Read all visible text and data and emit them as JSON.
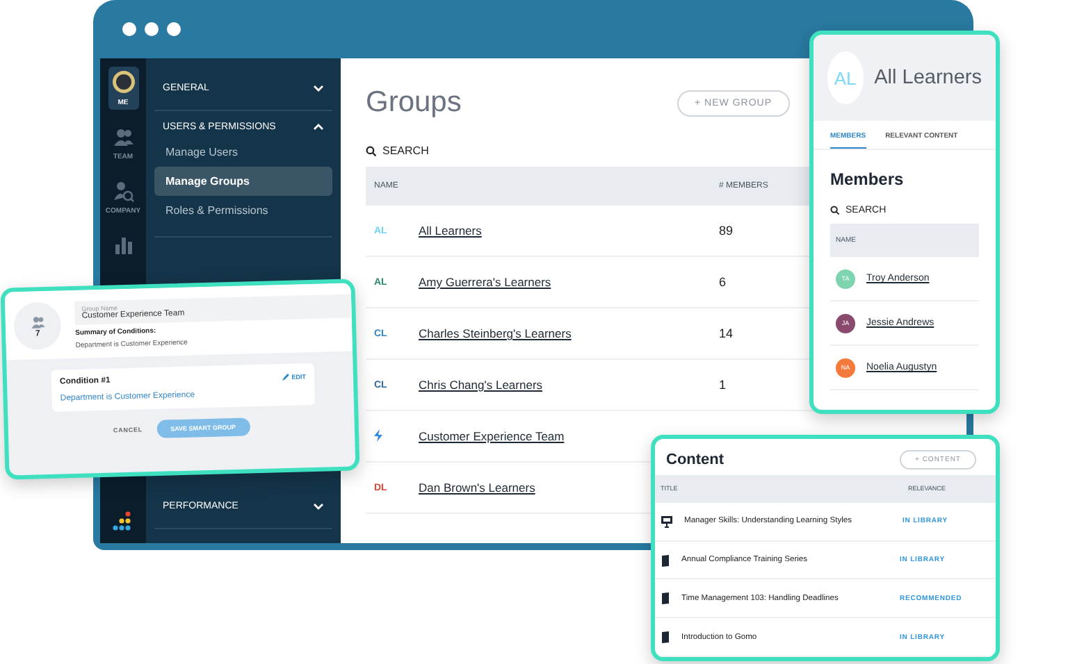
{
  "window": {
    "rail": [
      {
        "kind": "avatar",
        "label": "ME",
        "selected": true
      },
      {
        "kind": "team",
        "label": "TEAM",
        "selected": false
      },
      {
        "kind": "company",
        "label": "COMPANY",
        "selected": false
      },
      {
        "kind": "chart",
        "selected": false
      }
    ],
    "nav": [
      {
        "label": "GENERAL",
        "expanded": false
      },
      {
        "label": "USERS & PERMISSIONS",
        "expanded": true,
        "children": [
          {
            "label": "Manage Users",
            "selected": false
          },
          {
            "label": "Manage Groups",
            "selected": true
          },
          {
            "label": "Roles & Permissions",
            "selected": false
          }
        ]
      },
      {
        "label": "PERFORMANCE",
        "expanded": false
      }
    ]
  },
  "groups": {
    "title": "Groups",
    "new_button": "+ NEW GROUP",
    "search": "SEARCH",
    "columns": [
      "NAME",
      "# MEMBERS"
    ],
    "rows": [
      {
        "kind": "initials",
        "initials": "AL",
        "color": "#6fd3f5",
        "name": "All Learners",
        "members": "89"
      },
      {
        "kind": "initials",
        "initials": "AL",
        "color": "#2e8b6e",
        "name": "Amy Guerrera's Learners",
        "members": "6"
      },
      {
        "kind": "initials",
        "initials": "CL",
        "color": "#2f86c9",
        "name": "Charles Steinberg's Learners",
        "members": "14"
      },
      {
        "kind": "initials",
        "initials": "CL",
        "color": "#2e6aa0",
        "name": "Chris Chang's Learners",
        "members": "1"
      },
      {
        "kind": "smart",
        "color": "#2f86e0",
        "name": "Customer Experience Team"
      },
      {
        "kind": "initials",
        "initials": "DL",
        "color": "#e0463a",
        "name": "Dan Brown's Learners"
      }
    ]
  },
  "smart_group": {
    "count": "7",
    "field_label": "Group Name",
    "field_value": "Customer Experience Team",
    "summary_title": "Summary of Conditions:",
    "summary": "Department is Customer Experience",
    "condition_title": "Condition #1",
    "edit": "EDIT",
    "condition": "Department is Customer Experience",
    "cancel": "CANCEL",
    "save": "SAVE SMART GROUP"
  },
  "learner_card": {
    "initials": "AL",
    "title": "All Learners",
    "tabs": [
      {
        "label": "MEMBERS",
        "selected": true
      },
      {
        "label": "RELEVANT CONTENT",
        "selected": false
      }
    ],
    "heading": "Members",
    "search": "SEARCH",
    "column": "NAME",
    "members": [
      {
        "initials": "TA",
        "name": "Troy Anderson",
        "color": "#7fd4b0"
      },
      {
        "initials": "JA",
        "name": "Jessie Andrews",
        "color": "#8a4a6e"
      },
      {
        "initials": "NA",
        "name": "Noelia Augustyn",
        "color": "#f47a3c"
      }
    ]
  },
  "content_card": {
    "title": "Content",
    "add_button": "+ CONTENT",
    "columns": [
      "TITLE",
      "RELEVANCE"
    ],
    "rows": [
      {
        "kind": "presentation",
        "title": "Manager Skills: Understanding Learning Styles",
        "relevance": "IN LIBRARY"
      },
      {
        "kind": "book",
        "title": "Annual Compliance Training Series",
        "relevance": "IN LIBRARY"
      },
      {
        "kind": "book",
        "title": "Time Management 103: Handling Deadlines",
        "relevance": "RECOMMENDED"
      },
      {
        "kind": "book",
        "title": "Introduction to Gomo",
        "relevance": "IN LIBRARY"
      }
    ]
  }
}
